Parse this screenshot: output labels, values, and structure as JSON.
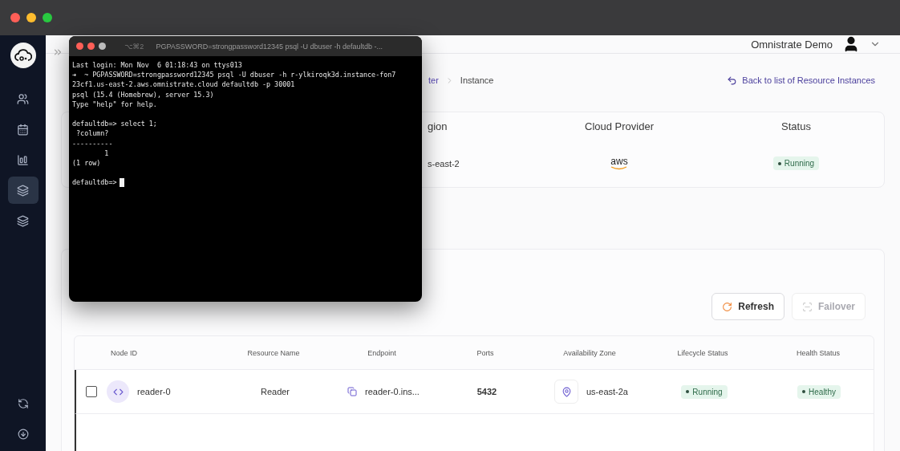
{
  "sidebar": {
    "items": [
      {
        "selected": false
      },
      {
        "selected": false
      },
      {
        "selected": false
      },
      {
        "selected": true
      },
      {
        "selected": false
      }
    ]
  },
  "header": {
    "account_name": "Omnistrate Demo"
  },
  "breadcrumb": {
    "items": [
      "ter",
      "Instance"
    ]
  },
  "back_link": "Back to list of Resource Instances",
  "instance_summary": {
    "columns": [
      "gion",
      "Cloud Provider",
      "Status"
    ],
    "region": "s-east-2",
    "cloud_provider": "aws",
    "status": "Running"
  },
  "actions": [
    {
      "label": "Refresh",
      "disabled": false
    },
    {
      "label": "Failover",
      "disabled": true
    }
  ],
  "nodes_table": {
    "columns": [
      "Node ID",
      "Resource Name",
      "Endpoint",
      "Ports",
      "Availability Zone",
      "Lifecycle Status",
      "Health Status"
    ],
    "rows": [
      {
        "node_id": "reader-0",
        "resource_name": "Reader",
        "endpoint": "reader-0.ins...",
        "ports": "5432",
        "zone": "us-east-2a",
        "lifecycle": "Running",
        "health": "Healthy",
        "checked": false
      }
    ]
  },
  "terminal": {
    "shortcut": "⌥⌘2",
    "title": "PGPASSWORD=strongpassword12345 psql -U dbuser -h  defaultdb -...",
    "blocks": [
      [
        "Last login: Mon Nov  6 01:18:43 on ttys013",
        "➜  ~ PGPASSWORD=strongpassword12345 psql -U dbuser -h r-ylkiroqk3d.instance-fon7",
        "23cf1.us-east-2.aws.omnistrate.cloud defaultdb -p 30001",
        "psql (15.4 (Homebrew), server 15.3)",
        "Type \"help\" for help."
      ],
      [
        "defaultdb=> select 1;",
        " ?column?",
        "----------",
        "        1",
        "(1 row)"
      ],
      [
        "defaultdb=>"
      ]
    ]
  }
}
